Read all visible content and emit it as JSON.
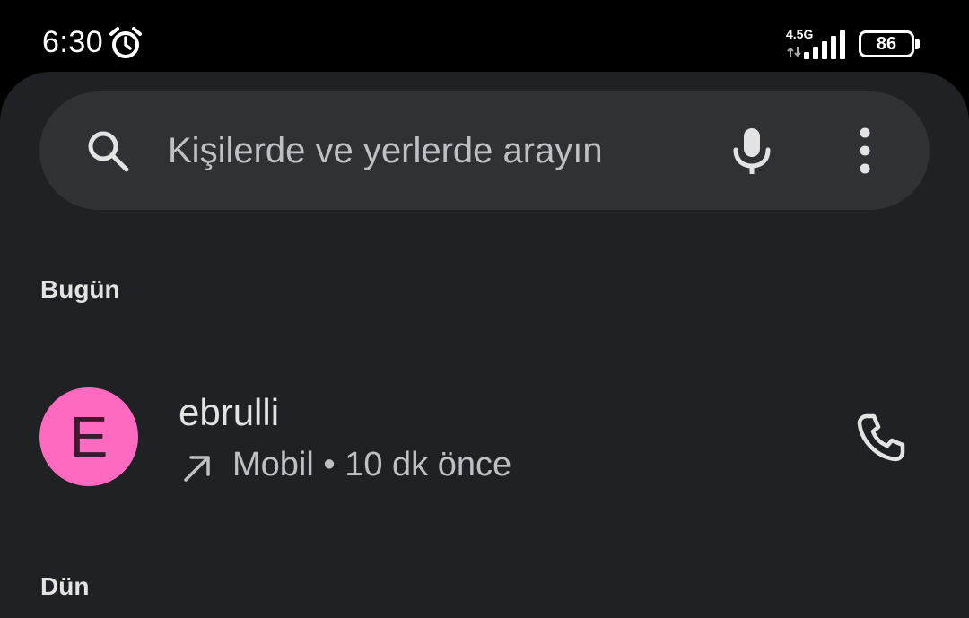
{
  "status_bar": {
    "time": "6:30",
    "network_label": "4.5G",
    "battery_level": "86",
    "icons": [
      "alarm-icon",
      "signal-icon",
      "data-arrows-icon",
      "battery-icon"
    ]
  },
  "search": {
    "placeholder": "Kişilerde ve yerlerde arayın",
    "icons": [
      "search-icon",
      "mic-icon",
      "more-vert-icon"
    ]
  },
  "sections": {
    "today": "Bugün",
    "yesterday": "Dün"
  },
  "calls": [
    {
      "avatar_letter": "E",
      "avatar_color": "#ff6ac1",
      "name": "ebrulli",
      "call_type_icon": "outgoing-call-icon",
      "detail": "Mobil • 10 dk önce",
      "action_icon": "phone-icon"
    }
  ],
  "colors": {
    "background": "#202124",
    "search_bg": "#303134",
    "text_primary": "#e3e3e3",
    "text_secondary": "#bdc1c6"
  }
}
